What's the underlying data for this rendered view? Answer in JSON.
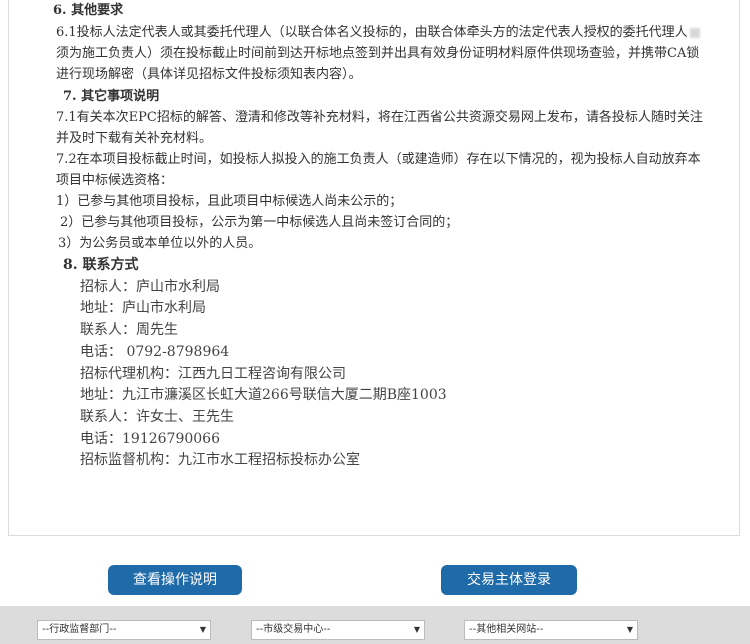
{
  "document": {
    "sec6_title": "6. 其他要求",
    "sec6_l1": "6.1投标人法定代表人或其委托代理人（以联合体名义投标的，由联合体牵头方的法定代表人授权的委托代理人",
    "sec6_l2": "须为施工负责人）须在投标截止时间前到达开标地点签到并出具有效身份证明材料原件供现场查验，并携带CA锁",
    "sec6_l3": "进行现场解密（具体详见招标文件投标须知表内容）。",
    "sec7_title": "7. 其它事项说明",
    "sec7_1_l1": "7.1有关本次EPC招标的解答、澄清和修改等补充材料，将在江西省公共资源交易网上发布，请各投标人随时关注",
    "sec7_1_l2": "并及时下载有关补充材料。",
    "sec7_2_l1": "7.2在本项目投标截止时间，如投标人拟投入的施工负责人（或建造师）存在以下情况的，视为投标人自动放弃本",
    "sec7_2_l2": "项目中标候选资格：",
    "item1": "1）已参与其他项目投标，且此项目中标候选人尚未公示的；",
    "item2": "2）已参与其他项目投标，公示为第一中标候选人且尚未签订合同的；",
    "item3": "3）为公务员或本单位以外的人员。",
    "sec8_title": "8. 联系方式",
    "contact": [
      "招标人：庐山市水利局",
      "地址：庐山市水利局",
      "联系人：周先生",
      "电话：  0792-8798964",
      "招标代理机构：江西九日工程咨询有限公司",
      "地址：九江市濂溪区长虹大道266号联信大厦二期B座1003",
      "联系人：许女士、王先生",
      "电话：19126790066",
      "招标监督机构：九江市水工程招标投标办公室"
    ]
  },
  "buttons": {
    "view_instructions": "查看操作说明",
    "login": "交易主体登录"
  },
  "footer": {
    "select1": "--行政监督部门--",
    "select2": "--市级交易中心--",
    "select3": "--其他相关网站--"
  },
  "colors": {
    "button_bg": "#1f6aa9",
    "footer_bg": "#dcdcdc"
  }
}
